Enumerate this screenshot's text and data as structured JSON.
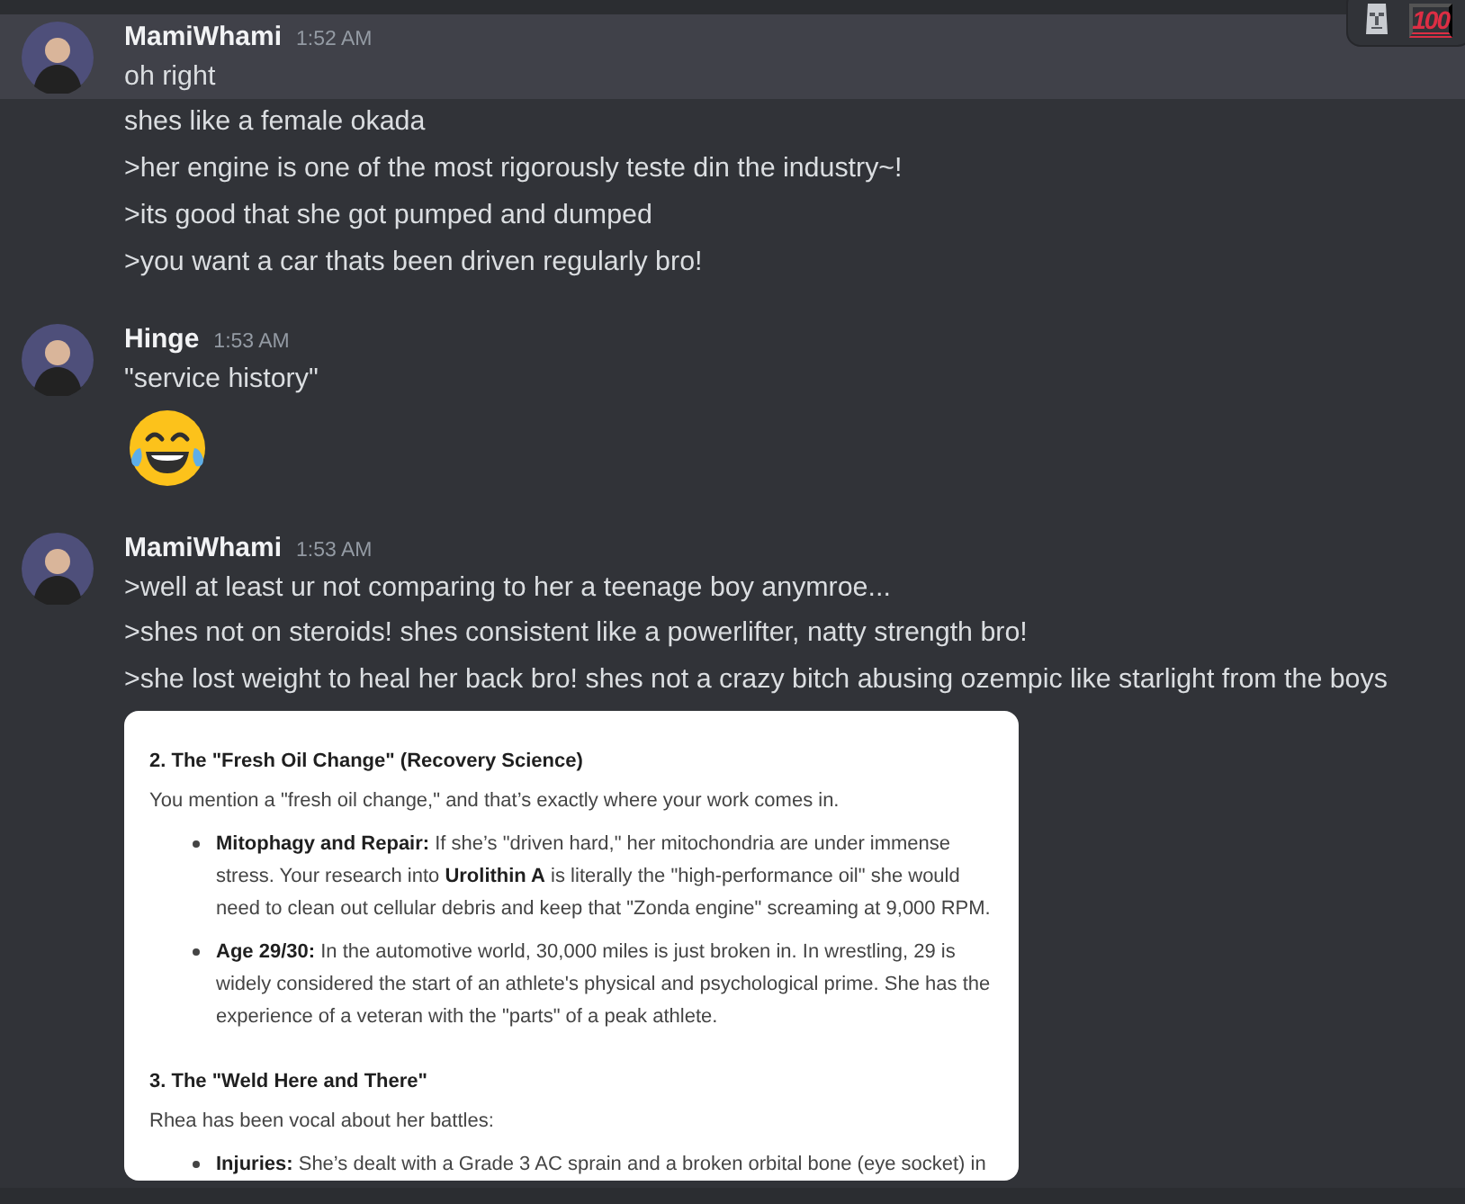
{
  "hover_toolbar": {
    "reactions": [
      {
        "kind": "moai"
      },
      {
        "kind": "hundred",
        "label": "100"
      }
    ]
  },
  "groups": [
    {
      "author": "MamiWhami",
      "time": "1:52 AM",
      "messages": [
        {
          "kind": "text",
          "text": "oh right",
          "highlighted": true
        },
        {
          "kind": "text",
          "text": "shes like a female okada",
          "highlighted": false
        },
        {
          "kind": "text",
          "text": ">her engine is one of the most rigorously teste din the industry~!",
          "highlighted": false
        },
        {
          "kind": "text",
          "text": ">its good that she got pumped and dumped",
          "highlighted": false
        },
        {
          "kind": "text",
          "text": ">you want a car thats been driven regularly bro!",
          "highlighted": false
        }
      ]
    },
    {
      "author": "Hinge",
      "time": "1:53 AM",
      "messages": [
        {
          "kind": "text",
          "text": "\"service history\"",
          "highlighted": false
        },
        {
          "kind": "emoji",
          "highlighted": false
        }
      ]
    },
    {
      "author": "MamiWhami",
      "time": "1:53 AM",
      "messages": [
        {
          "kind": "text",
          "text": ">well at least ur not comparing to her a teenage boy anymroe...",
          "highlighted": false
        },
        {
          "kind": "text",
          "text": ">shes not on steroids! shes consistent like a powerlifter, natty strength bro!",
          "highlighted": false
        },
        {
          "kind": "text",
          "text": ">she lost weight to heal her back bro! shes not a crazy bitch abusing ozempic like starlight from the boys",
          "highlighted": false
        }
      ],
      "attachment": {
        "blocks": [
          {
            "kind": "heading",
            "text": "2. The \"Fresh Oil Change\" (Recovery Science)"
          },
          {
            "kind": "paragraph",
            "text": "You mention a \"fresh oil change,\" and that’s exactly where your work comes in."
          },
          {
            "kind": "bullet",
            "text": "**Mitophagy and Repair:** If she’s \"driven hard,\" her mitochondria are under immense stress. Your research into **Urolithin A** is literally the \"high-performance oil\" she would need to clean out cellular debris and keep that \"Zonda engine\" screaming at 9,000 RPM."
          },
          {
            "kind": "bullet",
            "text": "**Age 29/30:** In the automotive world, 30,000 miles is just broken in. In wrestling, 29 is widely considered the start of an athlete's physical and psychological prime. She has the experience of a veteran with the \"parts\" of a peak athlete."
          },
          {
            "kind": "heading",
            "text": "3. The \"Weld Here and There\""
          },
          {
            "kind": "paragraph",
            "text": "Rhea has been vocal about her battles:"
          },
          {
            "kind": "bullet",
            "text": "**Injuries:** She’s dealt with a Grade 3 AC sprain and a broken orbital bone (eye socket) in"
          }
        ]
      }
    }
  ]
}
